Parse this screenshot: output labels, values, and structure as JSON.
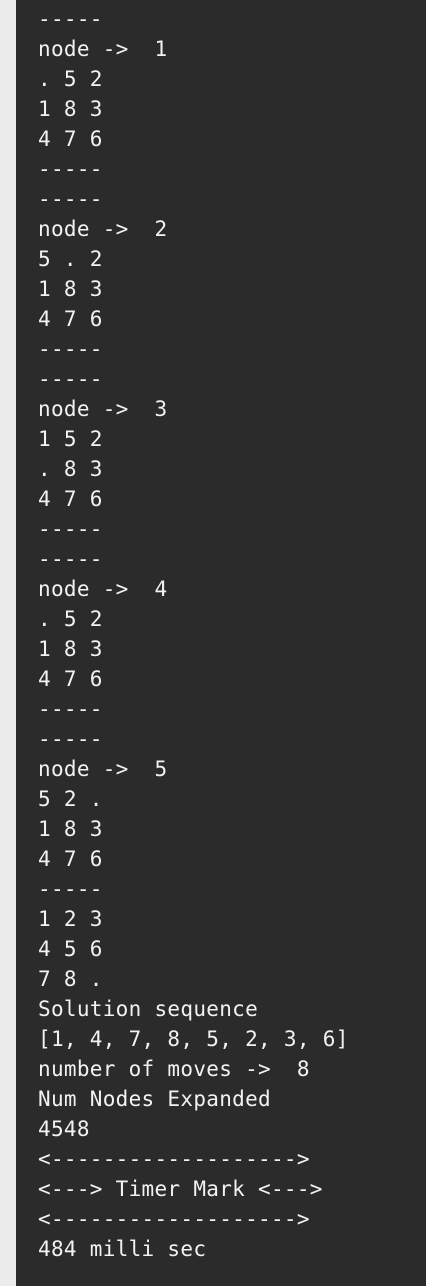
{
  "lines": [
    "-----",
    "node ->  1",
    ". 5 2",
    "1 8 3",
    "4 7 6",
    "-----",
    "-----",
    "node ->  2",
    "5 . 2",
    "1 8 3",
    "4 7 6",
    "-----",
    "-----",
    "node ->  3",
    "1 5 2",
    ". 8 3",
    "4 7 6",
    "-----",
    "-----",
    "node ->  4",
    ". 5 2",
    "1 8 3",
    "4 7 6",
    "-----",
    "-----",
    "node ->  5",
    "5 2 .",
    "1 8 3",
    "4 7 6",
    "-----",
    "1 2 3",
    "4 5 6",
    "7 8 .",
    "Solution sequence",
    "[1, 4, 7, 8, 5, 2, 3, 6]",
    "number of moves ->  8",
    "Num Nodes Expanded",
    "4548",
    "<------------------->",
    "<---> Timer Mark <--->",
    "<------------------->",
    "484 milli sec"
  ]
}
